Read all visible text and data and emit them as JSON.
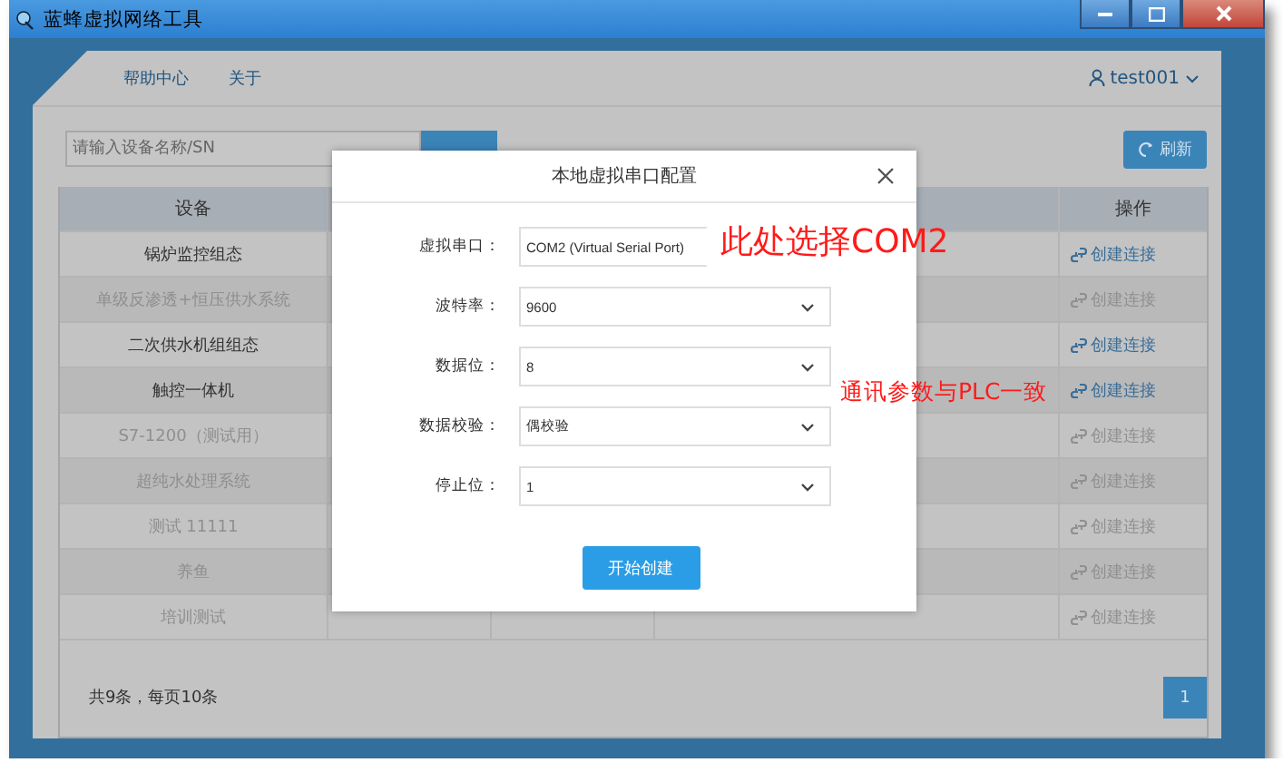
{
  "window": {
    "title": "蓝蜂虚拟网络工具"
  },
  "nav": {
    "links": [
      {
        "label": "帮助中心"
      },
      {
        "label": "关于"
      }
    ],
    "user": "test001"
  },
  "search": {
    "placeholder": "请输入设备名称/SN"
  },
  "refresh_button": "刷新",
  "table": {
    "columns": [
      "设备",
      "操作"
    ],
    "rows": [
      {
        "device": "锅炉监控组态",
        "action": "创建连接",
        "disabled": false
      },
      {
        "device": "单级反渗透+恒压供水系统",
        "action": "创建连接",
        "disabled": true
      },
      {
        "device": "二次供水机组组态",
        "action": "创建连接",
        "disabled": false
      },
      {
        "device": "触控一体机",
        "action": "创建连接",
        "disabled": false
      },
      {
        "device": "S7-1200（测试用）",
        "action": "创建连接",
        "disabled": true
      },
      {
        "device": "超纯水处理系统",
        "action": "创建连接",
        "disabled": true
      },
      {
        "device": "测试 11111",
        "action": "创建连接",
        "disabled": true
      },
      {
        "device": "养鱼",
        "action": "创建连接",
        "disabled": true
      },
      {
        "device": "培训测试",
        "action": "创建连接",
        "disabled": true
      }
    ]
  },
  "footer": {
    "summary": "共9条，每页10条",
    "pages": [
      {
        "label": "1",
        "selected": true
      }
    ]
  },
  "dialog": {
    "title": "本地虚拟串口配置",
    "fields": [
      {
        "label": "虚拟串口：",
        "value": "COM2 (Virtual Serial Port)",
        "caret_covered": true
      },
      {
        "label": "波特率：",
        "value": "9600"
      },
      {
        "label": "数据位：",
        "value": "8"
      },
      {
        "label": "数据校验：",
        "value": "偶校验"
      },
      {
        "label": "停止位：",
        "value": "1"
      }
    ],
    "submit": "开始创建"
  },
  "annotations": [
    {
      "text": "此处选择COM2"
    },
    {
      "text": "通讯参数与PLC一致"
    }
  ]
}
